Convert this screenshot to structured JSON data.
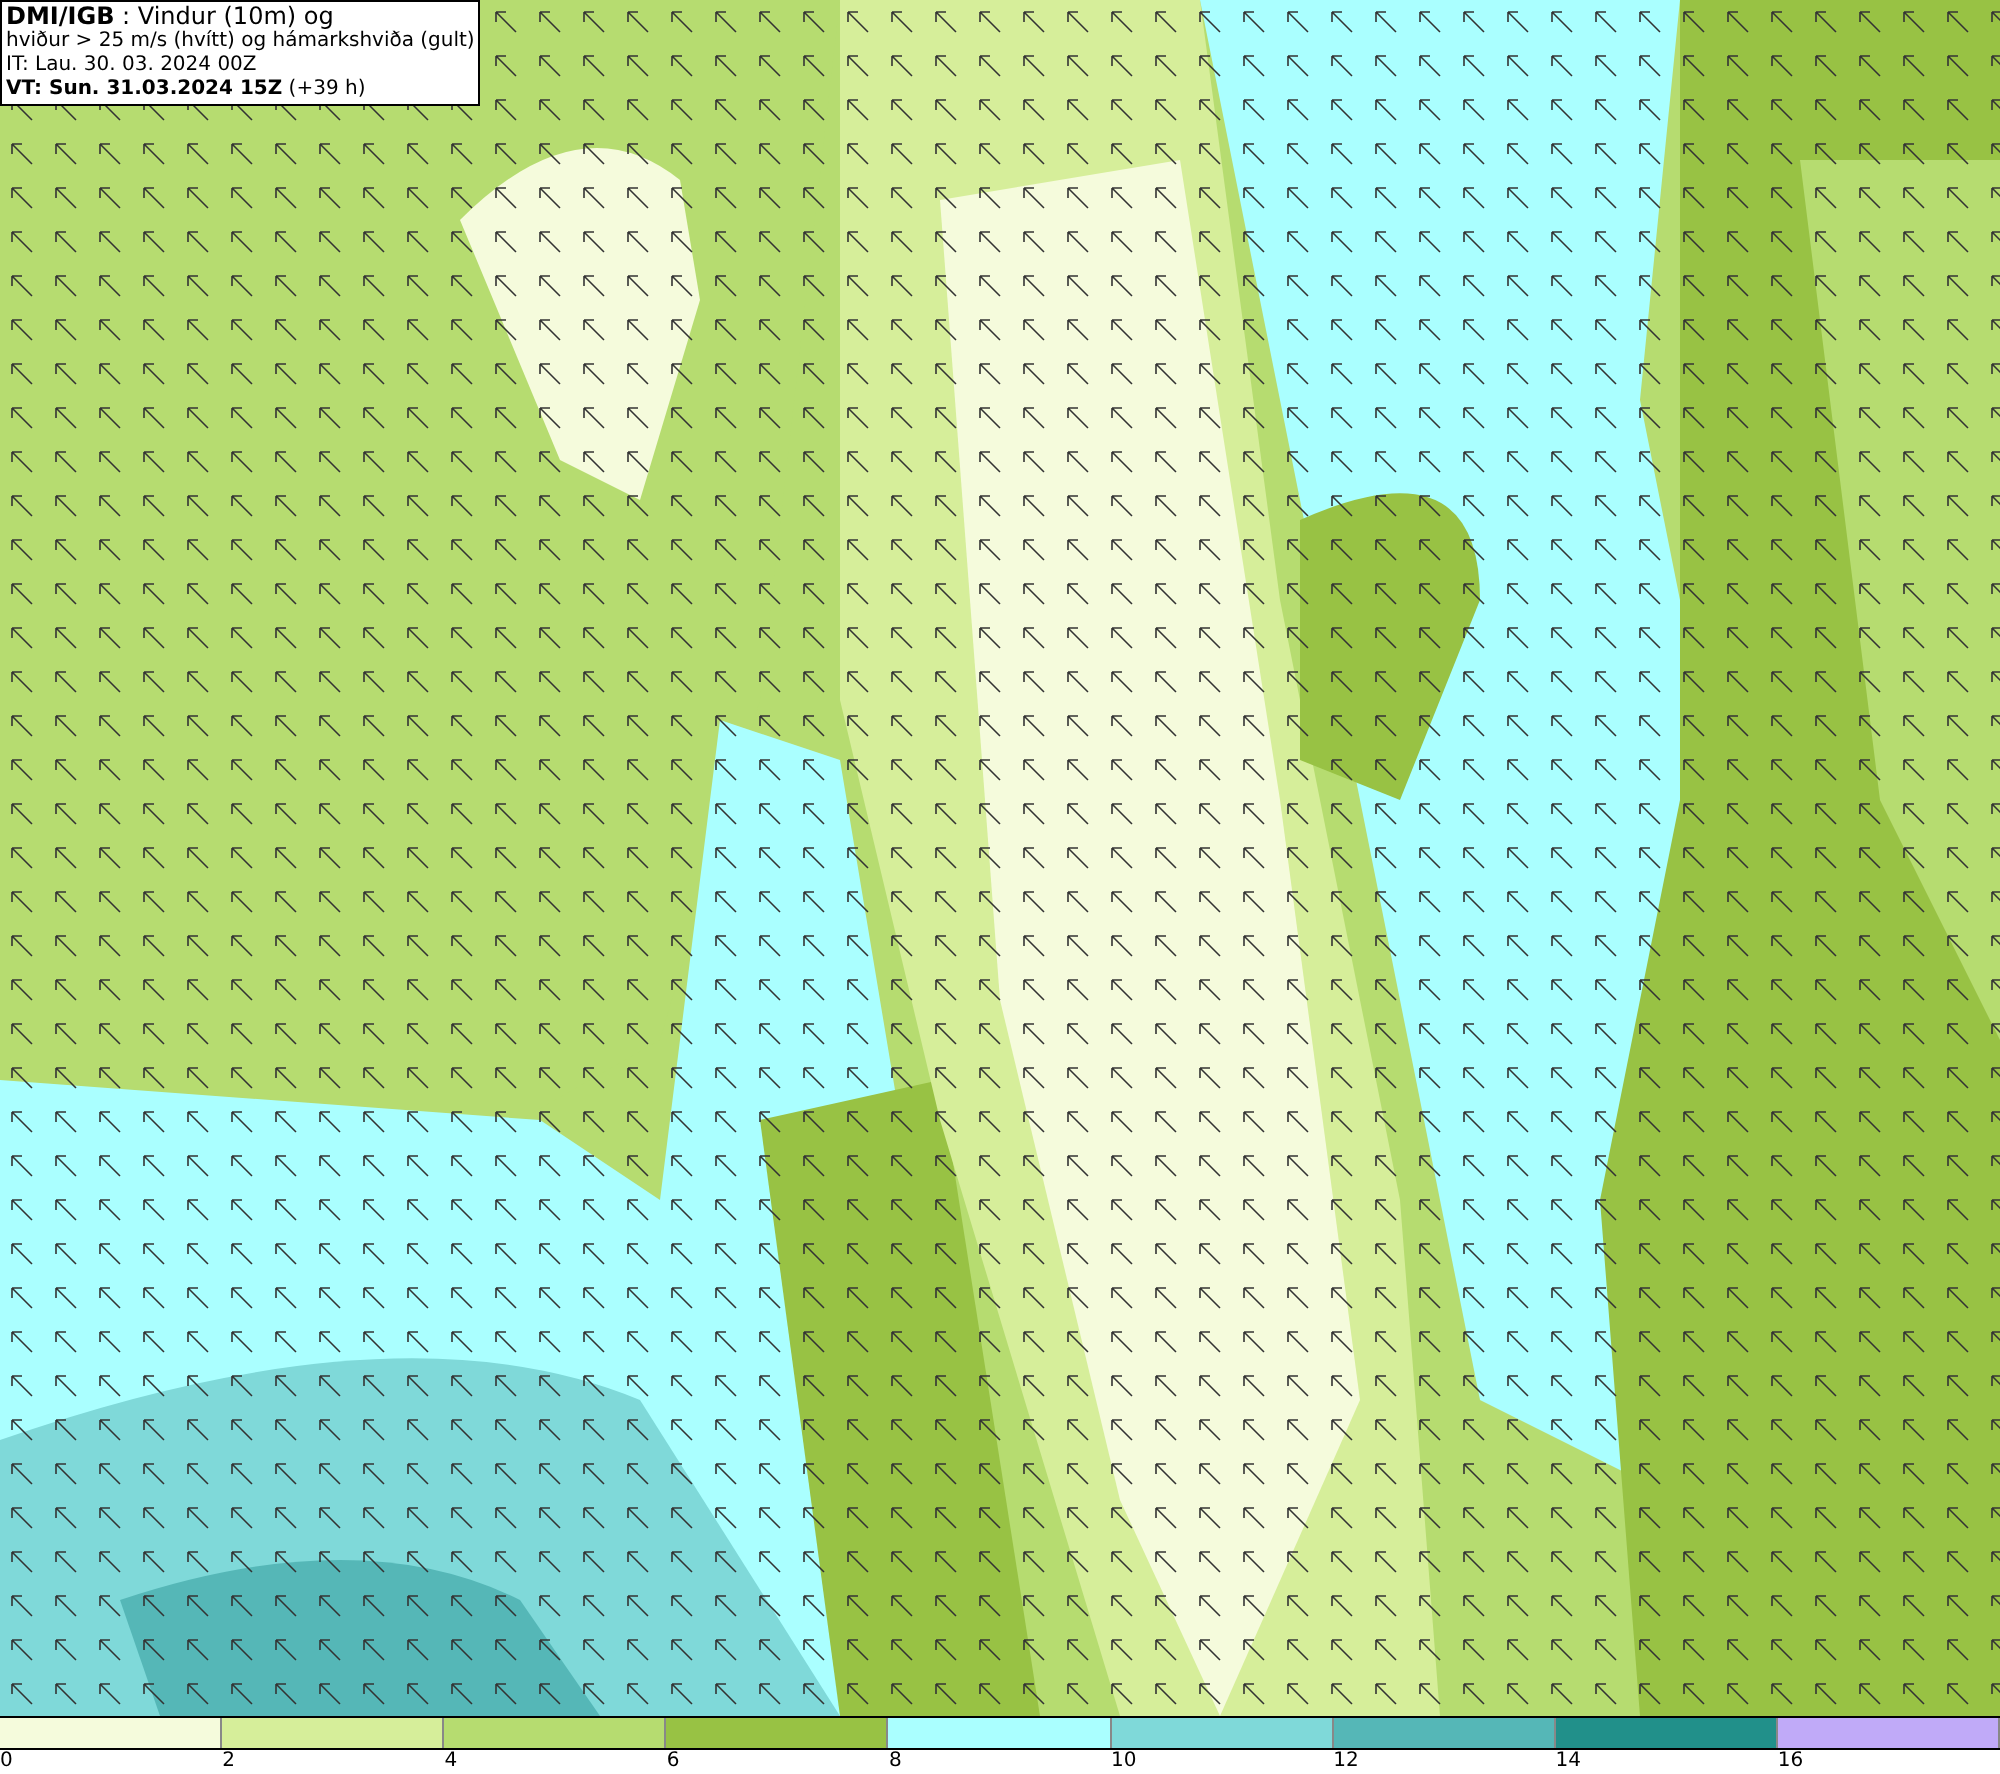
{
  "title_box": {
    "lines": [
      "**DMI/IGB** : Vindur (10m) og",
      "hviður > 25 m/s (hvítt) og hámarkshviða (gult)",
      "IT: Lau. 30. 03. 2024 00Z",
      "**VT: Sun. 31.03.2024 15Z** (+39 h)"
    ]
  },
  "legend": [
    {
      "label": "0",
      "color": "#f5fbdc"
    },
    {
      "label": "2",
      "color": "#d6ee9a"
    },
    {
      "label": "4",
      "color": "#b6dc70"
    },
    {
      "label": "6",
      "color": "#98c244"
    },
    {
      "label": "8",
      "color": "#aaffff"
    },
    {
      "label": "10",
      "color": "#7fd9d9"
    },
    {
      "label": "12",
      "color": "#55b7b7"
    },
    {
      "label": "14",
      "color": "#21908a"
    },
    {
      "label": "16",
      "color": "#c0aaf8"
    }
  ]
}
